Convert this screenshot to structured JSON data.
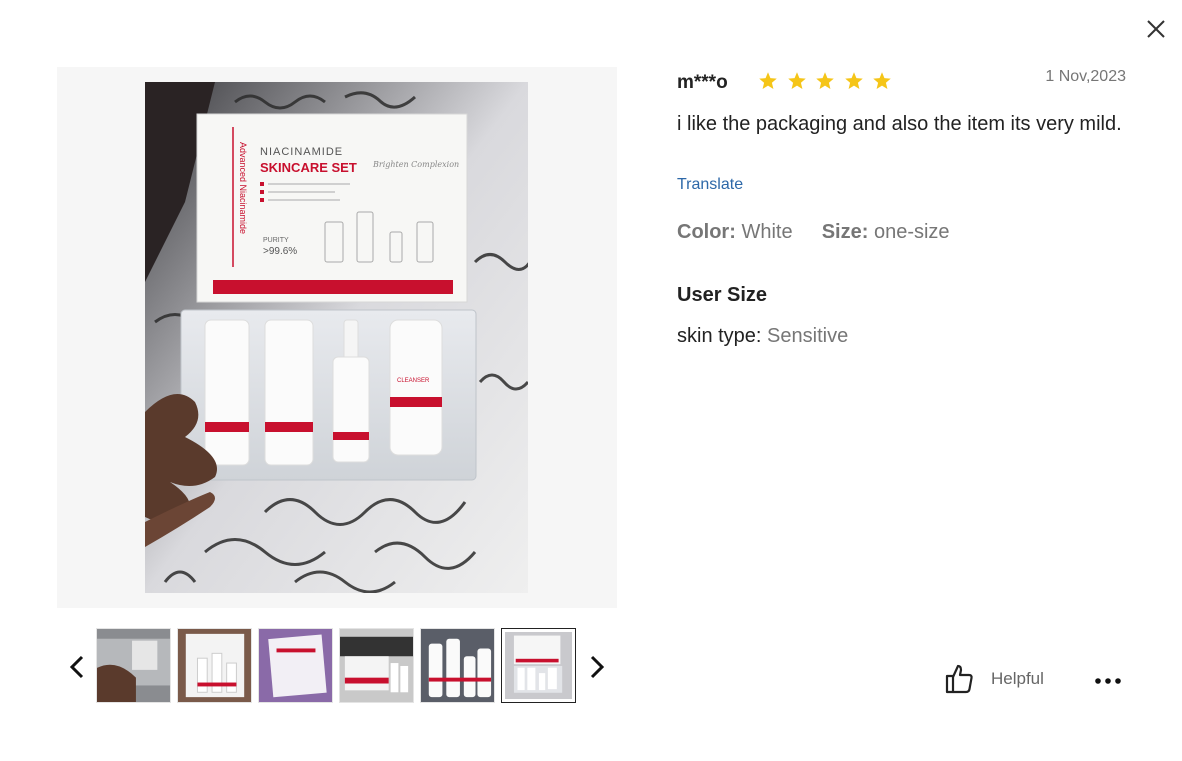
{
  "review": {
    "username": "m***o",
    "rating": 5,
    "date": "1 Nov,2023",
    "text": "i like the packaging and also the item its very mild.",
    "translate_label": "Translate",
    "color_key": "Color:",
    "color_value": "White",
    "size_key": "Size:",
    "size_value": "one-size",
    "user_size_title": "User Size",
    "skin_key": "skin type:",
    "skin_value": "Sensitive"
  },
  "photo": {
    "box_brand_line": "NIACINAMIDE",
    "box_title": "SKINCARE SET",
    "box_side_text": "Advanced Niacinamide",
    "box_purity_label": "PURITY",
    "box_purity_value": ">99.6%",
    "box_script_text": "Brighten Complexion",
    "cleanser_label": "CLEANSER"
  },
  "thumbnails": {
    "count": 6,
    "active_index": 5
  },
  "actions": {
    "helpful_label": "Helpful"
  },
  "icons": {
    "close": "close-icon",
    "prev": "chevron-left-icon",
    "next": "chevron-right-icon",
    "helpful": "thumbs-up-icon",
    "more": "more-dots-icon",
    "star": "star-icon"
  },
  "colors": {
    "star": "#f5c518",
    "link": "#2d68a8",
    "muted": "#767676",
    "brand_red": "#c8102e"
  }
}
